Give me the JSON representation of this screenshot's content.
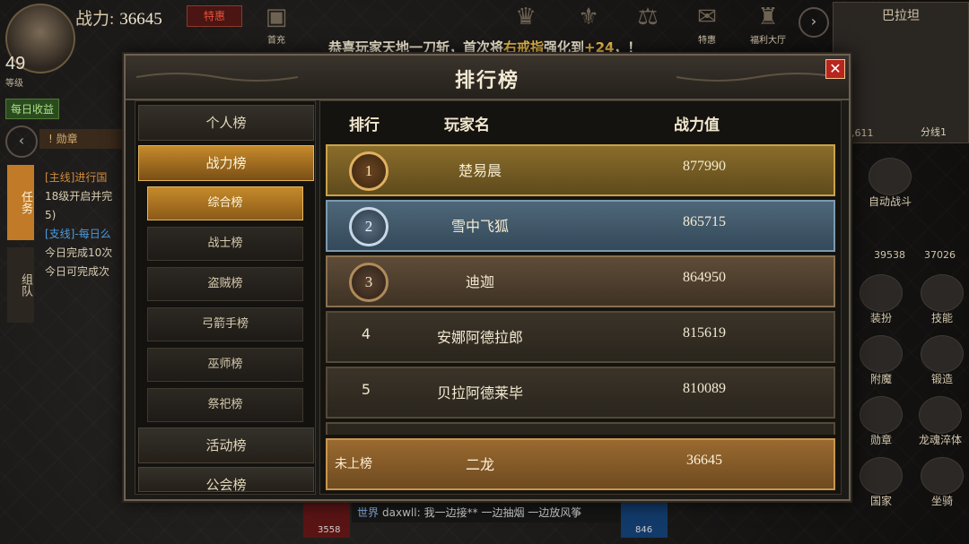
{
  "hud": {
    "power_label": "战力:",
    "power_value": "36645",
    "vip_button": "特惠",
    "level": "49",
    "level_sub": "等级",
    "daily_income": "每日收益",
    "medal_tag": "! 勋章",
    "top_icons": [
      {
        "label": "首充",
        "icon": "gift-icon"
      },
      {
        "label": "",
        "icon": "activity-icon"
      },
      {
        "label": "",
        "icon": "vip-icon"
      },
      {
        "label": "",
        "icon": "reward-icon"
      },
      {
        "label": "",
        "icon": "scale-icon"
      },
      {
        "label": "特惠",
        "icon": "deal-icon"
      },
      {
        "label": "福利大厅",
        "icon": "welfare-icon"
      }
    ],
    "minimap": {
      "name": "巴拉坦",
      "coords": "75,611",
      "line": "分线1"
    },
    "quest_tab": "任务",
    "team_tab": "组队",
    "quest_lines": [
      "[主线]进行国",
      "18级开启并完",
      "5)",
      "[支线]-每日么",
      "今日完成10次",
      "今日可完成次"
    ],
    "side_icons": [
      {
        "label": "自动战斗",
        "icon": "auto-battle-icon"
      },
      {
        "label": "装扮",
        "icon": "dress-icon"
      },
      {
        "label": "技能",
        "icon": "skill-icon"
      },
      {
        "label": "附魔",
        "icon": "enchant-icon"
      },
      {
        "label": "锻造",
        "icon": "forge-icon"
      },
      {
        "label": "勋章",
        "icon": "medal-icon"
      },
      {
        "label": "龙魂淬体",
        "icon": "dragon-soul-icon"
      },
      {
        "label": "国家",
        "icon": "nation-icon"
      },
      {
        "label": "坐骑",
        "icon": "mount-icon"
      }
    ],
    "hp_value": "39538",
    "mp_value": "37026",
    "bottom_left_num": "3558",
    "bottom_right_num": "846",
    "chat": {
      "channel": "世界",
      "name": "daxwll:",
      "text": "我一边接** 一边抽烟 一边放风筝"
    }
  },
  "announcement": {
    "prefix": "恭喜玩家天地一刀斩，首次将",
    "item": "右戒指",
    "mid": "强化到",
    "level": "+24",
    "suffix": "，！"
  },
  "leaderboard": {
    "title": "排行榜",
    "close": "✕",
    "categories": [
      {
        "label": "个人榜"
      },
      {
        "label": "战力榜"
      },
      {
        "label": "活动榜"
      },
      {
        "label": "公会榜"
      }
    ],
    "subcategories": [
      {
        "label": "综合榜"
      },
      {
        "label": "战士榜"
      },
      {
        "label": "盗贼榜"
      },
      {
        "label": "弓箭手榜"
      },
      {
        "label": "巫师榜"
      },
      {
        "label": "祭祀榜"
      }
    ],
    "headers": {
      "rank": "排行",
      "name": "玩家名",
      "power": "战力值"
    },
    "rows": [
      {
        "rank": "1",
        "name": "楚易晨",
        "power": "877990"
      },
      {
        "rank": "2",
        "name": "雪中飞狐",
        "power": "865715"
      },
      {
        "rank": "3",
        "name": "迪迦",
        "power": "864950"
      },
      {
        "rank": "4",
        "name": "安娜阿德拉郎",
        "power": "815619"
      },
      {
        "rank": "5",
        "name": "贝拉阿德莱毕",
        "power": "810089"
      }
    ],
    "me": {
      "rank": "未上榜",
      "name": "二龙",
      "power": "36645"
    }
  }
}
